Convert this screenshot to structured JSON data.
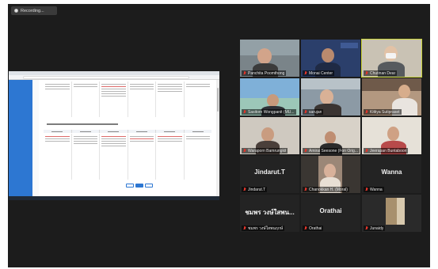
{
  "recording": {
    "label": "Recording..."
  },
  "shared_screen": {
    "title": "",
    "section_heading": ""
  },
  "participants": [
    {
      "name": "Panchita Poomthong",
      "display": "",
      "video": true,
      "muted": true
    },
    {
      "name": "Monai Center",
      "display": "",
      "video": true,
      "muted": true
    },
    {
      "name": "Chutinan Dear",
      "display": "",
      "video": true,
      "muted": true,
      "active_speaker": true
    },
    {
      "name": "Sasitorn Wongpanit (MU...",
      "display": "",
      "video": true,
      "muted": true
    },
    {
      "name": "sarujan",
      "display": "",
      "video": true,
      "muted": true
    },
    {
      "name": "Kittiya Sutipraset",
      "display": "",
      "video": true,
      "muted": true
    },
    {
      "name": "Waraporn Bamrungkit",
      "display": "",
      "video": true,
      "muted": true
    },
    {
      "name": "Amirai Seesone (Fon Orig...",
      "display": "",
      "video": true,
      "muted": true
    },
    {
      "name": "Jeerapan Buntaboon",
      "display": "",
      "video": true,
      "muted": true
    },
    {
      "name": "Jindarut.T",
      "display": "Jindarut.T",
      "video": false,
      "muted": true
    },
    {
      "name": "Chanokkan H. (Moral)",
      "display": "",
      "video": true,
      "muted": true
    },
    {
      "name": "Wanna",
      "display": "Wanna",
      "video": false,
      "muted": true
    },
    {
      "name": "ชมพร วงษ์ใสพนฤกษ์",
      "display": "ชมพร วงษ์ใสพน...",
      "video": false,
      "muted": true
    },
    {
      "name": "Orathai",
      "display": "Orathai",
      "video": false,
      "muted": true
    },
    {
      "name": "Junaidy",
      "display": "",
      "video": true,
      "muted": true
    }
  ],
  "colors": {
    "active_outline": "#c9d33b",
    "muted_mic": "#e0352b",
    "doc_sidebar": "#2d77d2"
  }
}
